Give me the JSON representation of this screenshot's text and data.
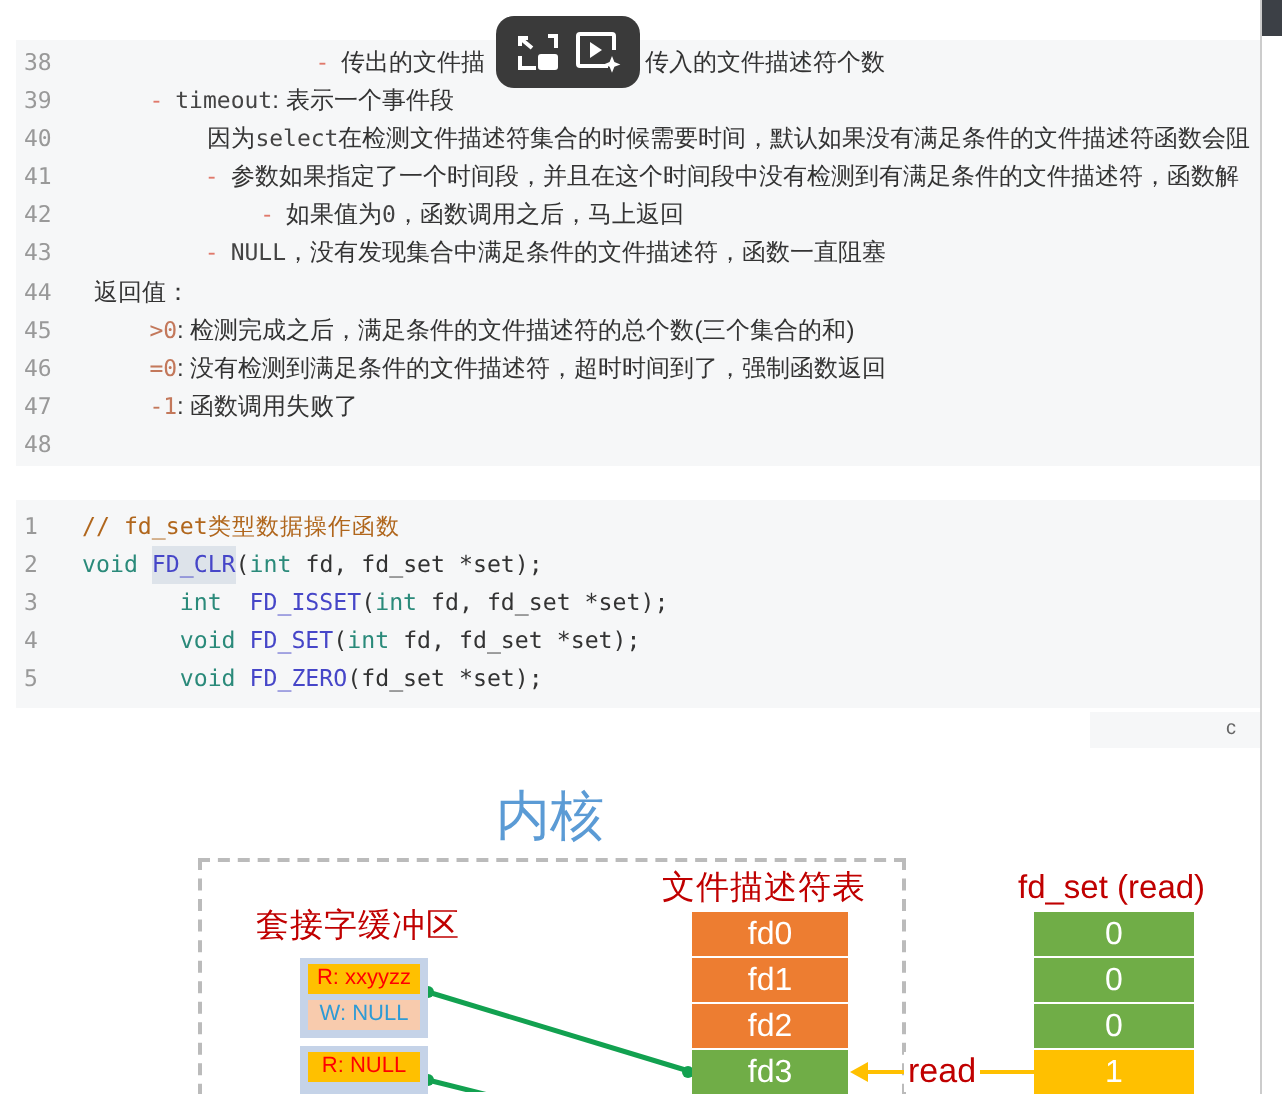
{
  "notes_block": {
    "lines": [
      {
        "number": "38",
        "covered": true,
        "segments": [
          {
            "kind": "bullet",
            "text": "                -"
          },
          {
            "kind": "text",
            "text": "传出的文件描"
          },
          {
            "kind": "text",
            "text": "传入的文件描述符个数"
          }
        ]
      },
      {
        "number": "39",
        "segments": [
          {
            "kind": "bullet",
            "text": "    -"
          },
          {
            "kind": "code",
            "text": "timeout"
          },
          {
            "kind": "text",
            "text": ": 表示一个事件段"
          }
        ]
      },
      {
        "number": "40",
        "segments": [
          {
            "kind": "text",
            "text": "                 因为"
          },
          {
            "kind": "code",
            "text": "select"
          },
          {
            "kind": "text",
            "text": "在检测文件描述符集合的时候需要时间，默认如果没有满足条件的文件描述符函数会阻"
          }
        ]
      },
      {
        "number": "41",
        "segments": [
          {
            "kind": "bullet",
            "text": "        -"
          },
          {
            "kind": "text",
            "text": "参数如果指定了一个时间段，并且在这个时间段中没有检测到有满足条件的文件描述符，函数解"
          }
        ]
      },
      {
        "number": "42",
        "segments": [
          {
            "kind": "bullet",
            "text": "            -"
          },
          {
            "kind": "text",
            "text": "如果值为"
          },
          {
            "kind": "code",
            "text": "0"
          },
          {
            "kind": "text",
            "text": "，函数调用之后，马上返回"
          }
        ]
      },
      {
        "number": "43",
        "segments": [
          {
            "kind": "bullet",
            "text": "        -"
          },
          {
            "kind": "code",
            "text": "NULL"
          },
          {
            "kind": "text",
            "text": "，没有发现集合中满足条件的文件描述符，函数一直阻塞"
          }
        ]
      },
      {
        "number": "44",
        "segments": [
          {
            "kind": "text",
            "text": "返回值："
          }
        ]
      },
      {
        "number": "45",
        "segments": [
          {
            "kind": "value",
            "text": "    >0"
          },
          {
            "kind": "text",
            "text": ": 检测完成之后，满足条件的文件描述符的总个数(三个集合的和)"
          }
        ]
      },
      {
        "number": "46",
        "segments": [
          {
            "kind": "value",
            "text": "    =0"
          },
          {
            "kind": "text",
            "text": ": 没有检测到满足条件的文件描述符，超时时间到了，强制函数返回"
          }
        ]
      },
      {
        "number": "47",
        "segments": [
          {
            "kind": "value",
            "text": "    -1"
          },
          {
            "kind": "text",
            "text": ": 函数调用失败了"
          }
        ]
      },
      {
        "number": "48"
      }
    ]
  },
  "code_block": {
    "lines": [
      {
        "number": "1",
        "segments": [
          {
            "kind": "comment",
            "text": "// fd_set类型数据操作函数",
            "highlighted": false
          }
        ]
      },
      {
        "number": "2",
        "segments": [
          {
            "kind": "keyword",
            "text": "void ",
            "highlighted": false
          },
          {
            "kind": "function",
            "text": "FD_CLR",
            "highlighted": true
          },
          {
            "kind": "plain",
            "text": "(",
            "highlighted": false
          },
          {
            "kind": "keyword",
            "text": "int",
            "highlighted": false
          },
          {
            "kind": "plain",
            "text": " fd, fd_set *set);",
            "highlighted": false
          }
        ]
      },
      {
        "number": "3",
        "segments": [
          {
            "kind": "keyword",
            "text": "       int  ",
            "highlighted": false
          },
          {
            "kind": "function",
            "text": "FD_ISSET",
            "highlighted": false
          },
          {
            "kind": "plain",
            "text": "(",
            "highlighted": false
          },
          {
            "kind": "keyword",
            "text": "int",
            "highlighted": false
          },
          {
            "kind": "plain",
            "text": " fd, fd_set *set);",
            "highlighted": false
          }
        ]
      },
      {
        "number": "4",
        "segments": [
          {
            "kind": "keyword",
            "text": "       void ",
            "highlighted": false
          },
          {
            "kind": "function",
            "text": "FD_SET",
            "highlighted": false
          },
          {
            "kind": "plain",
            "text": "(",
            "highlighted": false
          },
          {
            "kind": "keyword",
            "text": "int",
            "highlighted": false
          },
          {
            "kind": "plain",
            "text": " fd, fd_set *set);",
            "highlighted": false
          }
        ]
      },
      {
        "number": "5",
        "segments": [
          {
            "kind": "keyword",
            "text": "       void ",
            "highlighted": false
          },
          {
            "kind": "function",
            "text": "FD_ZERO",
            "highlighted": false
          },
          {
            "kind": "plain",
            "text": "(fd_set *set);",
            "highlighted": false
          }
        ]
      }
    ]
  },
  "language_tab": {
    "label": "c"
  },
  "diagram": {
    "title": "内核",
    "socket_buffers": {
      "title": "套接字缓冲区",
      "buffers": [
        {
          "read": "R: xxyyzz",
          "write": "W: NULL"
        },
        {
          "read": "R: NULL"
        }
      ]
    },
    "fd_table": {
      "title": "文件描述符表",
      "cells": [
        {
          "label": "fd0",
          "color": "#ed7d31"
        },
        {
          "label": "fd1",
          "color": "#ed7d31"
        },
        {
          "label": "fd2",
          "color": "#ed7d31"
        },
        {
          "label": "fd3",
          "color": "#70ad47"
        }
      ]
    },
    "fd_set": {
      "title": "fd_set (read)",
      "cells": [
        {
          "value": "0",
          "color": "#70ad47"
        },
        {
          "value": "0",
          "color": "#70ad47"
        },
        {
          "value": "0",
          "color": "#70ad47"
        },
        {
          "value": "1",
          "color": "#ffc000"
        }
      ]
    },
    "arrow_label": "read"
  }
}
